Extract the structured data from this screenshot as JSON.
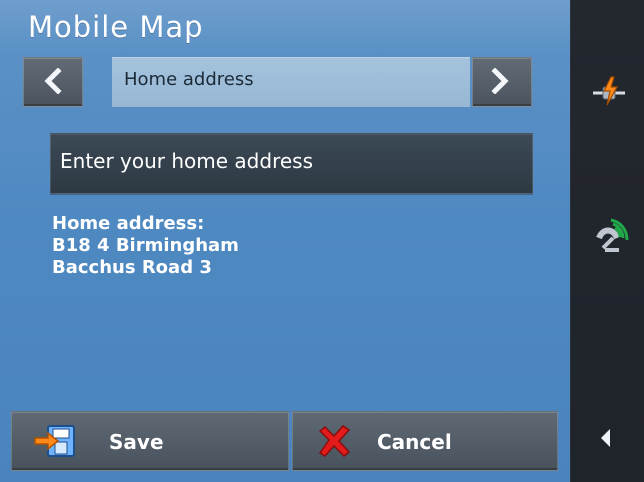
{
  "header": {
    "title": "Mobile Map"
  },
  "selector": {
    "value": "Home address"
  },
  "prompt": {
    "label": "Enter your home address"
  },
  "address_block": {
    "lines": [
      "Home address:",
      "B18 4 Birmingham",
      "Bacchus Road 3"
    ]
  },
  "actions": {
    "save_label": "Save",
    "cancel_label": "Cancel"
  },
  "icons": {
    "prev": "chevron-left-icon",
    "next": "chevron-right-icon",
    "save": "save-floppy-icon",
    "cancel": "cancel-x-icon",
    "side_top": "connection-icon",
    "side_mid": "gps-satellite-icon",
    "side_bottom": "back-arrow-icon"
  },
  "colors": {
    "panel_blue": "#4f89c1",
    "sidebar_dark": "#1f232a",
    "button_gray": "#4b545e",
    "cancel_red": "#e31b1b",
    "save_orange": "#ff8a1a",
    "gps_green": "#21a84a"
  }
}
